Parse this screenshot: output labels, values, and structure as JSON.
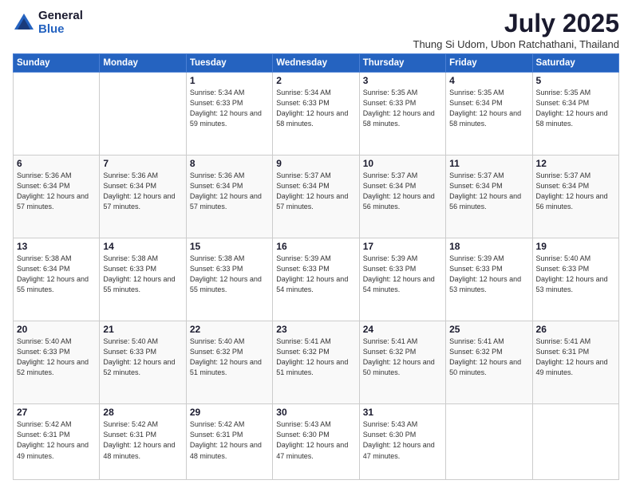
{
  "logo": {
    "general": "General",
    "blue": "Blue"
  },
  "header": {
    "month": "July 2025",
    "location": "Thung Si Udom, Ubon Ratchathani, Thailand"
  },
  "weekdays": [
    "Sunday",
    "Monday",
    "Tuesday",
    "Wednesday",
    "Thursday",
    "Friday",
    "Saturday"
  ],
  "weeks": [
    [
      {
        "day": "",
        "sunrise": "",
        "sunset": "",
        "daylight": ""
      },
      {
        "day": "",
        "sunrise": "",
        "sunset": "",
        "daylight": ""
      },
      {
        "day": "1",
        "sunrise": "Sunrise: 5:34 AM",
        "sunset": "Sunset: 6:33 PM",
        "daylight": "Daylight: 12 hours and 59 minutes."
      },
      {
        "day": "2",
        "sunrise": "Sunrise: 5:34 AM",
        "sunset": "Sunset: 6:33 PM",
        "daylight": "Daylight: 12 hours and 58 minutes."
      },
      {
        "day": "3",
        "sunrise": "Sunrise: 5:35 AM",
        "sunset": "Sunset: 6:33 PM",
        "daylight": "Daylight: 12 hours and 58 minutes."
      },
      {
        "day": "4",
        "sunrise": "Sunrise: 5:35 AM",
        "sunset": "Sunset: 6:34 PM",
        "daylight": "Daylight: 12 hours and 58 minutes."
      },
      {
        "day": "5",
        "sunrise": "Sunrise: 5:35 AM",
        "sunset": "Sunset: 6:34 PM",
        "daylight": "Daylight: 12 hours and 58 minutes."
      }
    ],
    [
      {
        "day": "6",
        "sunrise": "Sunrise: 5:36 AM",
        "sunset": "Sunset: 6:34 PM",
        "daylight": "Daylight: 12 hours and 57 minutes."
      },
      {
        "day": "7",
        "sunrise": "Sunrise: 5:36 AM",
        "sunset": "Sunset: 6:34 PM",
        "daylight": "Daylight: 12 hours and 57 minutes."
      },
      {
        "day": "8",
        "sunrise": "Sunrise: 5:36 AM",
        "sunset": "Sunset: 6:34 PM",
        "daylight": "Daylight: 12 hours and 57 minutes."
      },
      {
        "day": "9",
        "sunrise": "Sunrise: 5:37 AM",
        "sunset": "Sunset: 6:34 PM",
        "daylight": "Daylight: 12 hours and 57 minutes."
      },
      {
        "day": "10",
        "sunrise": "Sunrise: 5:37 AM",
        "sunset": "Sunset: 6:34 PM",
        "daylight": "Daylight: 12 hours and 56 minutes."
      },
      {
        "day": "11",
        "sunrise": "Sunrise: 5:37 AM",
        "sunset": "Sunset: 6:34 PM",
        "daylight": "Daylight: 12 hours and 56 minutes."
      },
      {
        "day": "12",
        "sunrise": "Sunrise: 5:37 AM",
        "sunset": "Sunset: 6:34 PM",
        "daylight": "Daylight: 12 hours and 56 minutes."
      }
    ],
    [
      {
        "day": "13",
        "sunrise": "Sunrise: 5:38 AM",
        "sunset": "Sunset: 6:34 PM",
        "daylight": "Daylight: 12 hours and 55 minutes."
      },
      {
        "day": "14",
        "sunrise": "Sunrise: 5:38 AM",
        "sunset": "Sunset: 6:33 PM",
        "daylight": "Daylight: 12 hours and 55 minutes."
      },
      {
        "day": "15",
        "sunrise": "Sunrise: 5:38 AM",
        "sunset": "Sunset: 6:33 PM",
        "daylight": "Daylight: 12 hours and 55 minutes."
      },
      {
        "day": "16",
        "sunrise": "Sunrise: 5:39 AM",
        "sunset": "Sunset: 6:33 PM",
        "daylight": "Daylight: 12 hours and 54 minutes."
      },
      {
        "day": "17",
        "sunrise": "Sunrise: 5:39 AM",
        "sunset": "Sunset: 6:33 PM",
        "daylight": "Daylight: 12 hours and 54 minutes."
      },
      {
        "day": "18",
        "sunrise": "Sunrise: 5:39 AM",
        "sunset": "Sunset: 6:33 PM",
        "daylight": "Daylight: 12 hours and 53 minutes."
      },
      {
        "day": "19",
        "sunrise": "Sunrise: 5:40 AM",
        "sunset": "Sunset: 6:33 PM",
        "daylight": "Daylight: 12 hours and 53 minutes."
      }
    ],
    [
      {
        "day": "20",
        "sunrise": "Sunrise: 5:40 AM",
        "sunset": "Sunset: 6:33 PM",
        "daylight": "Daylight: 12 hours and 52 minutes."
      },
      {
        "day": "21",
        "sunrise": "Sunrise: 5:40 AM",
        "sunset": "Sunset: 6:33 PM",
        "daylight": "Daylight: 12 hours and 52 minutes."
      },
      {
        "day": "22",
        "sunrise": "Sunrise: 5:40 AM",
        "sunset": "Sunset: 6:32 PM",
        "daylight": "Daylight: 12 hours and 51 minutes."
      },
      {
        "day": "23",
        "sunrise": "Sunrise: 5:41 AM",
        "sunset": "Sunset: 6:32 PM",
        "daylight": "Daylight: 12 hours and 51 minutes."
      },
      {
        "day": "24",
        "sunrise": "Sunrise: 5:41 AM",
        "sunset": "Sunset: 6:32 PM",
        "daylight": "Daylight: 12 hours and 50 minutes."
      },
      {
        "day": "25",
        "sunrise": "Sunrise: 5:41 AM",
        "sunset": "Sunset: 6:32 PM",
        "daylight": "Daylight: 12 hours and 50 minutes."
      },
      {
        "day": "26",
        "sunrise": "Sunrise: 5:41 AM",
        "sunset": "Sunset: 6:31 PM",
        "daylight": "Daylight: 12 hours and 49 minutes."
      }
    ],
    [
      {
        "day": "27",
        "sunrise": "Sunrise: 5:42 AM",
        "sunset": "Sunset: 6:31 PM",
        "daylight": "Daylight: 12 hours and 49 minutes."
      },
      {
        "day": "28",
        "sunrise": "Sunrise: 5:42 AM",
        "sunset": "Sunset: 6:31 PM",
        "daylight": "Daylight: 12 hours and 48 minutes."
      },
      {
        "day": "29",
        "sunrise": "Sunrise: 5:42 AM",
        "sunset": "Sunset: 6:31 PM",
        "daylight": "Daylight: 12 hours and 48 minutes."
      },
      {
        "day": "30",
        "sunrise": "Sunrise: 5:43 AM",
        "sunset": "Sunset: 6:30 PM",
        "daylight": "Daylight: 12 hours and 47 minutes."
      },
      {
        "day": "31",
        "sunrise": "Sunrise: 5:43 AM",
        "sunset": "Sunset: 6:30 PM",
        "daylight": "Daylight: 12 hours and 47 minutes."
      },
      {
        "day": "",
        "sunrise": "",
        "sunset": "",
        "daylight": ""
      },
      {
        "day": "",
        "sunrise": "",
        "sunset": "",
        "daylight": ""
      }
    ]
  ]
}
